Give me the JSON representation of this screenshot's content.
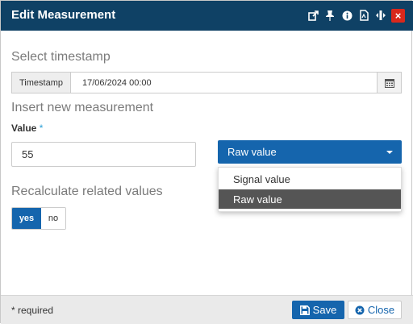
{
  "dialog": {
    "title": "Edit Measurement",
    "toolbar_icons": [
      "external-link-icon",
      "pin-icon",
      "info-icon",
      "pdf-icon",
      "resize-icon",
      "close-icon"
    ],
    "close_glyph": "×"
  },
  "timestamp": {
    "section_title": "Select timestamp",
    "addon_label": "Timestamp",
    "value": "17/06/2024 00:00"
  },
  "measurement": {
    "section_title": "Insert new measurement",
    "value_label": "Value",
    "required_mark": "*",
    "value": "55",
    "type_selected": "Raw value",
    "type_options": [
      "Signal value",
      "Raw value"
    ]
  },
  "recalculate": {
    "section_title": "Recalculate related values",
    "yes_label": "yes",
    "no_label": "no",
    "selected": "yes"
  },
  "footer": {
    "required_note": "* required",
    "save_label": "Save",
    "close_label": "Close"
  },
  "colors": {
    "titlebar": "#0f4165",
    "primary": "#1565ad",
    "close_red": "#d9281c",
    "menu_active": "#555555"
  }
}
